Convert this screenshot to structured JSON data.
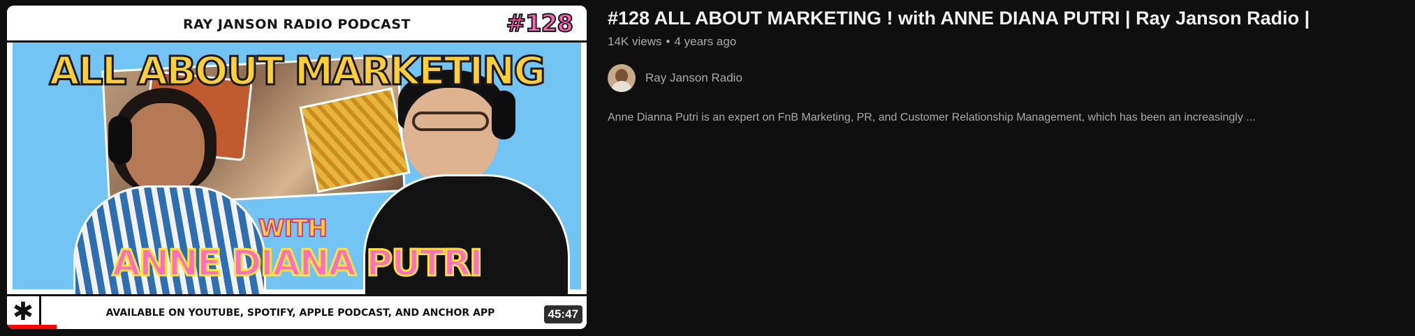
{
  "thumbnail": {
    "podcast_name": "RAY JANSON RADIO PODCAST",
    "episode_badge": "#128",
    "headline": "ALL ABOUT MARKETING",
    "with_text": "WITH",
    "guest_name": "ANNE DIANA PUTRI",
    "availability": "AVAILABLE ON YOUTUBE, SPOTIFY, APPLE PODCAST, AND ANCHOR APP",
    "asterisk": "✱",
    "duration": "45:47",
    "watch_progress_fraction": 0.085,
    "colors": {
      "sky": "#71c4f3",
      "headline": "#ffcf3a",
      "guest_name": "#ff6fc0",
      "badge": "#ff5fb5",
      "progress": "#ff0000"
    }
  },
  "video": {
    "title": "#128 ALL ABOUT MARKETING ! with ANNE DIANA PUTRI | Ray Janson Radio |",
    "views": "14K views",
    "separator": "•",
    "age": "4 years ago",
    "channel_name": "Ray Janson Radio",
    "description": "Anne Dianna Putri is an expert on FnB Marketing, PR, and Customer Relationship Management, which has been an increasingly ..."
  }
}
